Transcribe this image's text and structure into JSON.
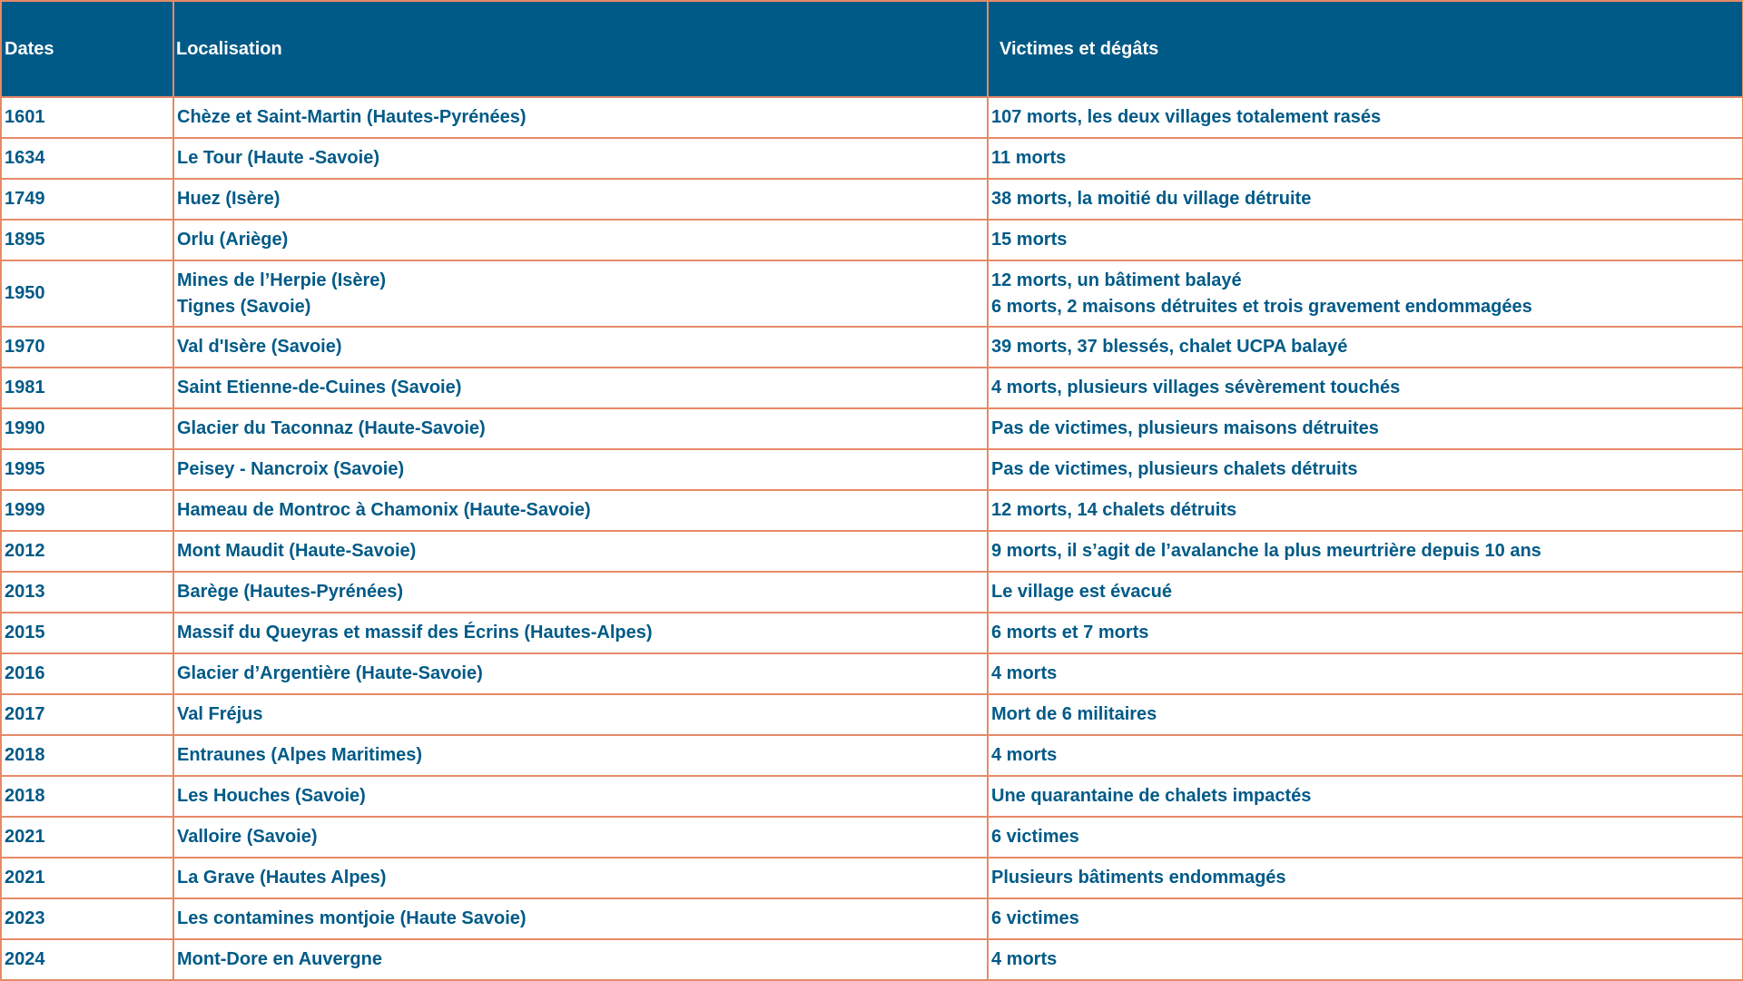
{
  "table": {
    "headers": [
      "Dates",
      "Localisation",
      "Victimes et dégâts"
    ],
    "rows": [
      {
        "date": "1601",
        "loc": [
          "Chèze et Saint-Martin (Hautes-Pyrénées)"
        ],
        "vic": [
          "107 morts, les deux villages totalement rasés"
        ]
      },
      {
        "date": "1634",
        "loc": [
          "Le Tour (Haute -Savoie)"
        ],
        "vic": [
          "11 morts"
        ]
      },
      {
        "date": "1749",
        "loc": [
          "Huez (Isère)"
        ],
        "vic": [
          "38 morts, la moitié du village détruite"
        ]
      },
      {
        "date": "1895",
        "loc": [
          "Orlu (Ariège)"
        ],
        "vic": [
          "15 morts"
        ]
      },
      {
        "date": "1950",
        "loc": [
          "Mines de l’Herpie (Isère)",
          "Tignes (Savoie)"
        ],
        "vic": [
          "12 morts, un bâtiment balayé",
          "6 morts, 2 maisons détruites et trois gravement endommagées"
        ]
      },
      {
        "date": "1970",
        "loc": [
          "Val d'Isère (Savoie)"
        ],
        "vic": [
          "39 morts, 37 blessés, chalet UCPA balayé"
        ]
      },
      {
        "date": "1981",
        "loc": [
          "Saint Etienne-de-Cuines (Savoie)"
        ],
        "vic": [
          "4 morts, plusieurs villages sévèrement touchés"
        ]
      },
      {
        "date": "1990",
        "loc": [
          "Glacier du Taconnaz (Haute-Savoie)"
        ],
        "vic": [
          "Pas de victimes, plusieurs maisons détruites"
        ]
      },
      {
        "date": "1995",
        "loc": [
          "Peisey - Nancroix (Savoie)"
        ],
        "vic": [
          "Pas de victimes, plusieurs chalets détruits"
        ]
      },
      {
        "date": "1999",
        "loc": [
          "Hameau de Montroc à Chamonix (Haute-Savoie)"
        ],
        "vic": [
          "12 morts, 14 chalets détruits"
        ]
      },
      {
        "date": "2012",
        "loc": [
          "Mont Maudit (Haute-Savoie)"
        ],
        "vic": [
          "9 morts, il s’agit de l’avalanche la plus meurtrière depuis 10 ans"
        ]
      },
      {
        "date": "2013",
        "loc": [
          "Barège (Hautes-Pyrénées)"
        ],
        "vic": [
          "Le village est évacué"
        ]
      },
      {
        "date": "2015",
        "loc": [
          "Massif du Queyras et massif des Écrins (Hautes-Alpes)"
        ],
        "vic": [
          "6 morts et 7 morts"
        ]
      },
      {
        "date": "2016",
        "loc": [
          "Glacier d’Argentière (Haute-Savoie)"
        ],
        "vic": [
          "4 morts"
        ]
      },
      {
        "date": "2017",
        "loc": [
          "Val Fréjus"
        ],
        "vic": [
          "Mort de 6 militaires"
        ]
      },
      {
        "date": "2018",
        "loc": [
          "Entraunes (Alpes Maritimes)"
        ],
        "vic": [
          "4 morts"
        ]
      },
      {
        "date": "2018",
        "loc": [
          "Les Houches (Savoie)"
        ],
        "vic": [
          "Une quarantaine de chalets impactés"
        ]
      },
      {
        "date": "2021",
        "loc": [
          "Valloire (Savoie)"
        ],
        "vic": [
          "6 victimes"
        ]
      },
      {
        "date": "2021",
        "loc": [
          "La Grave (Hautes Alpes)"
        ],
        "vic": [
          "Plusieurs bâtiments endommagés"
        ]
      },
      {
        "date": "2023",
        "loc": [
          "Les contamines montjoie (Haute Savoie)"
        ],
        "vic": [
          "6 victimes"
        ]
      },
      {
        "date": "2024",
        "loc": [
          "Mont-Dore en Auvergne"
        ],
        "vic": [
          "4 morts"
        ]
      }
    ]
  },
  "colors": {
    "header_bg": "#005a87",
    "header_text": "#ffffff",
    "body_text": "#005a87",
    "border": "#e58a67"
  }
}
